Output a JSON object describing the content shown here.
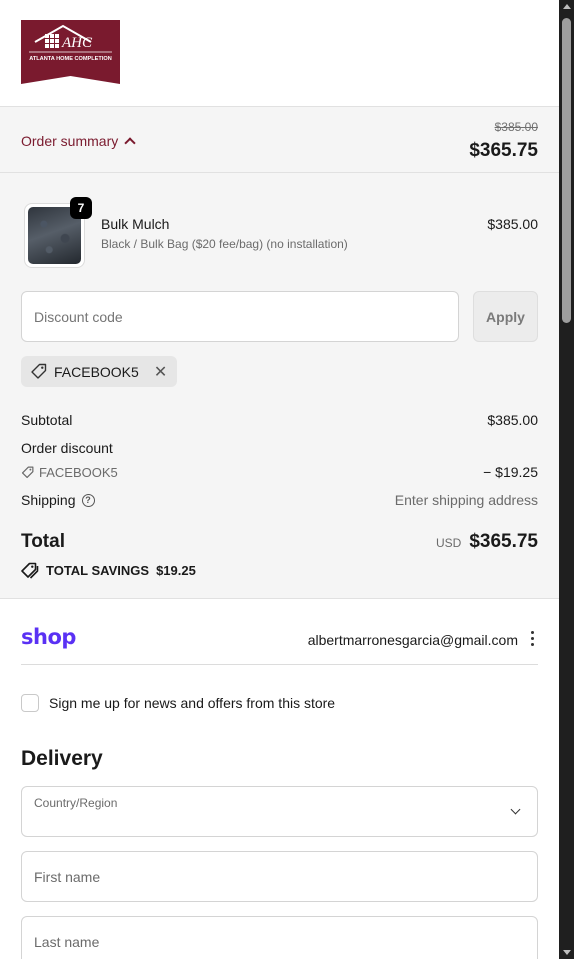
{
  "brand": {
    "logo_initials": "AHC",
    "logo_name": "ATLANTA HOME COMPLETION",
    "logo_color": "#7a1a2e"
  },
  "summary_bar": {
    "toggle_label": "Order summary",
    "original_price": "$385.00",
    "current_price": "$365.75"
  },
  "line_item": {
    "quantity": "7",
    "name": "Bulk Mulch",
    "variant": "Black / Bulk Bag ($20 fee/bag) (no installation)",
    "price": "$385.00"
  },
  "discount": {
    "placeholder": "Discount code",
    "apply_label": "Apply",
    "applied_code": "FACEBOOK5"
  },
  "totals": {
    "subtotal_label": "Subtotal",
    "subtotal_value": "$385.00",
    "order_discount_label": "Order discount",
    "discount_code": "FACEBOOK5",
    "discount_value": "− $19.25",
    "shipping_label": "Shipping",
    "shipping_value": "Enter shipping address",
    "total_label": "Total",
    "currency": "USD",
    "total_value": "$365.75",
    "savings_label": "TOTAL SAVINGS",
    "savings_value": "$19.25"
  },
  "shop_pay": {
    "logo_text": "shop",
    "email": "albertmarronesgarcia@gmail.com",
    "brand_color": "#5a31f4"
  },
  "newsletter": {
    "label": "Sign me up for news and offers from this store"
  },
  "delivery": {
    "heading": "Delivery",
    "country_label": "Country/Region",
    "first_name_placeholder": "First name",
    "last_name_placeholder": "Last name"
  }
}
